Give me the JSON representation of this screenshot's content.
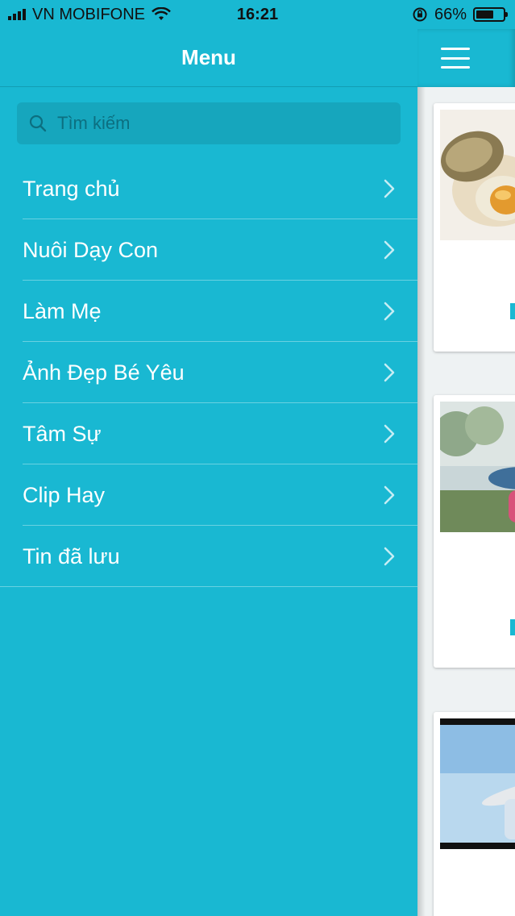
{
  "status_bar": {
    "carrier": "VN MOBIFONE",
    "time": "16:21",
    "battery": "66%",
    "battery_level": 0.66
  },
  "drawer": {
    "title": "Menu",
    "search": {
      "placeholder": "Tìm kiếm",
      "value": ""
    },
    "items": [
      {
        "label": "Trang chủ"
      },
      {
        "label": "Nuôi Dạy Con"
      },
      {
        "label": "Làm Mẹ"
      },
      {
        "label": "Ảnh Đẹp Bé Yêu"
      },
      {
        "label": "Tâm Sự"
      },
      {
        "label": "Clip Hay"
      },
      {
        "label": "Tin đã lưu"
      }
    ]
  },
  "colors": {
    "primary": "#19b8d2",
    "search_bg": "#16a6bd",
    "content_bg": "#eef2f3"
  },
  "icons": {
    "search": "search-icon",
    "chevron": "chevron-right-icon",
    "menu": "hamburger-menu-icon",
    "wifi": "wifi-icon",
    "battery": "battery-icon",
    "signal": "signal-icon",
    "orientation_lock": "orientation-lock-icon"
  }
}
